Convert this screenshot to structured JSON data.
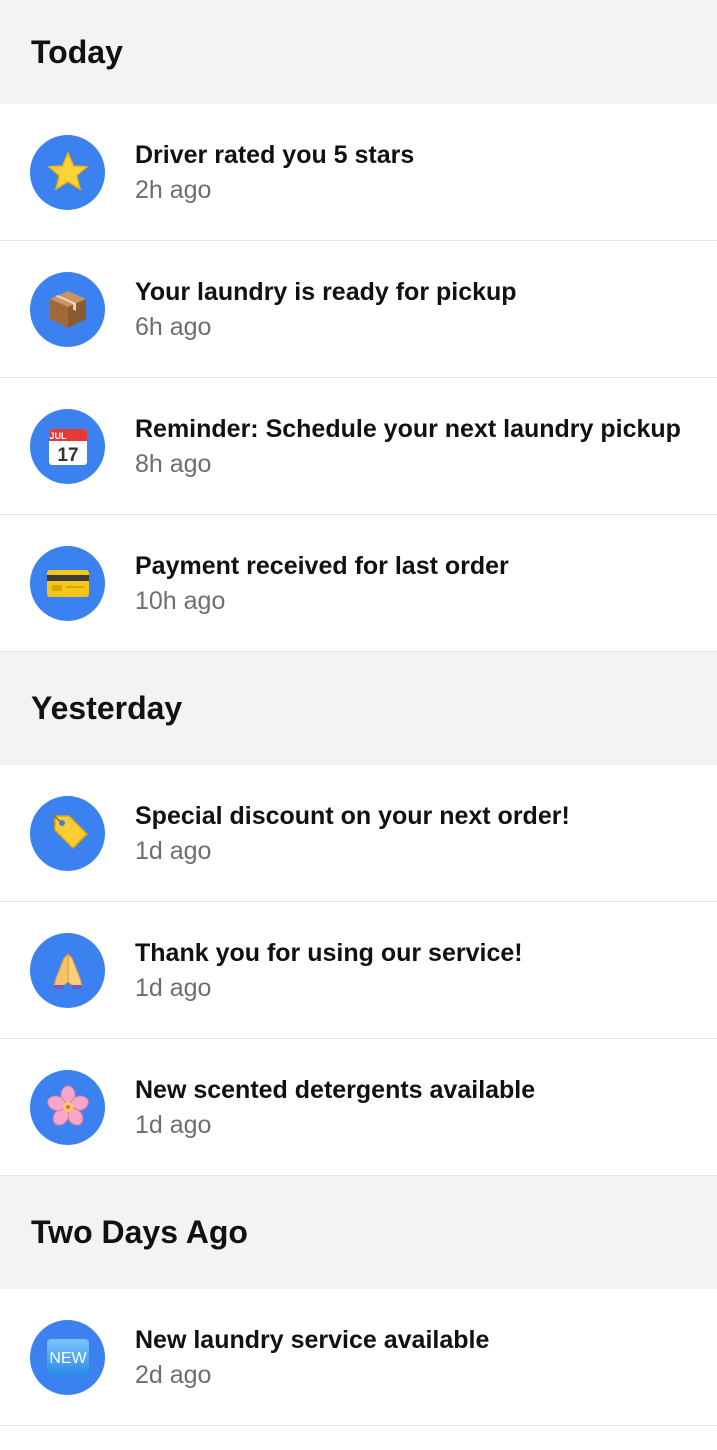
{
  "sections": [
    {
      "title": "Today",
      "items": [
        {
          "icon": "star-icon",
          "title": "Driver rated you 5 stars",
          "time": "2h ago"
        },
        {
          "icon": "package-icon",
          "title": "Your laundry is ready for pickup",
          "time": "6h ago"
        },
        {
          "icon": "calendar-icon",
          "title": "Reminder: Schedule your next laundry pickup",
          "time": "8h ago",
          "calendar_month": "JUL",
          "calendar_day": "17"
        },
        {
          "icon": "credit-card-icon",
          "title": "Payment received for last order",
          "time": "10h ago"
        }
      ]
    },
    {
      "title": "Yesterday",
      "items": [
        {
          "icon": "tag-icon",
          "title": "Special discount on your next order!",
          "time": "1d ago"
        },
        {
          "icon": "folded-hands-icon",
          "title": "Thank you for using our service!",
          "time": "1d ago"
        },
        {
          "icon": "cherry-blossom-icon",
          "title": "New scented detergents available",
          "time": "1d ago"
        }
      ]
    },
    {
      "title": "Two Days Ago",
      "items": [
        {
          "icon": "new-badge-icon",
          "title": "New laundry service available",
          "time": "2d ago",
          "badge_text": "NEW"
        }
      ]
    }
  ],
  "colors": {
    "avatar_background": "#3b82f0",
    "section_background": "#f2f3f5",
    "time_text": "#6b6e73",
    "divider": "#e3e4e6"
  }
}
